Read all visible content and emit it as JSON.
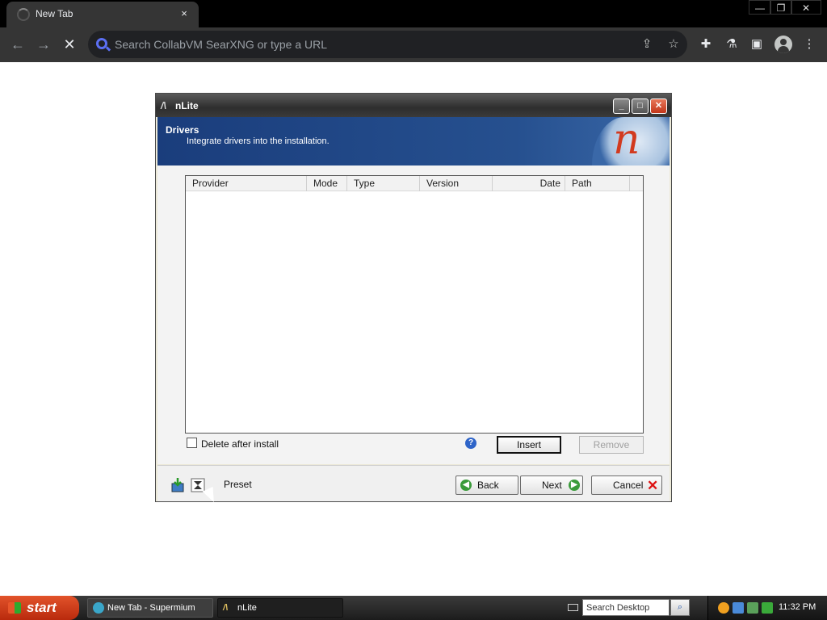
{
  "browser": {
    "tab_title": "New Tab",
    "tab_close": "×",
    "window_controls": {
      "minimize": "—",
      "restore": "❐",
      "close": "✕"
    },
    "nav": {
      "back": "←",
      "forward": "→",
      "stop": "✕"
    },
    "omnibox_placeholder": "Search CollabVM SearXNG or type a URL",
    "icons": [
      "share-icon",
      "bookmark-star-icon",
      "extensions-icon",
      "labs-icon",
      "sidepanel-icon",
      "profile-icon",
      "menu-icon"
    ]
  },
  "nlite": {
    "title": "nLite",
    "app_icon": "/\\",
    "title_buttons": {
      "minimize": "_",
      "maximize": "□",
      "close": "✕"
    },
    "banner_heading": "Drivers",
    "banner_sub": "Integrate drivers into the installation.",
    "logo_letter": "n",
    "columns": [
      "Provider",
      "Mode",
      "Type",
      "Version",
      "Date",
      "Path"
    ],
    "rows": [],
    "delete_after_install": {
      "label": "Delete after install",
      "checked": false
    },
    "help_glyph": "?",
    "insert_label": "Insert",
    "remove_label": "Remove",
    "preset_label": "Preset",
    "back_label": "Back",
    "next_label": "Next",
    "cancel_label": "Cancel"
  },
  "taskbar": {
    "start_label": "start",
    "items": [
      {
        "label": "New Tab - Supermium",
        "active": false
      },
      {
        "label": "nLite",
        "active": true
      }
    ],
    "desktop_search_placeholder": "Search Desktop",
    "clock": "11:32 PM"
  },
  "colors": {
    "banner": "#26508f",
    "start_button": "#d5441f",
    "accent_search": "#5b6ff3"
  }
}
